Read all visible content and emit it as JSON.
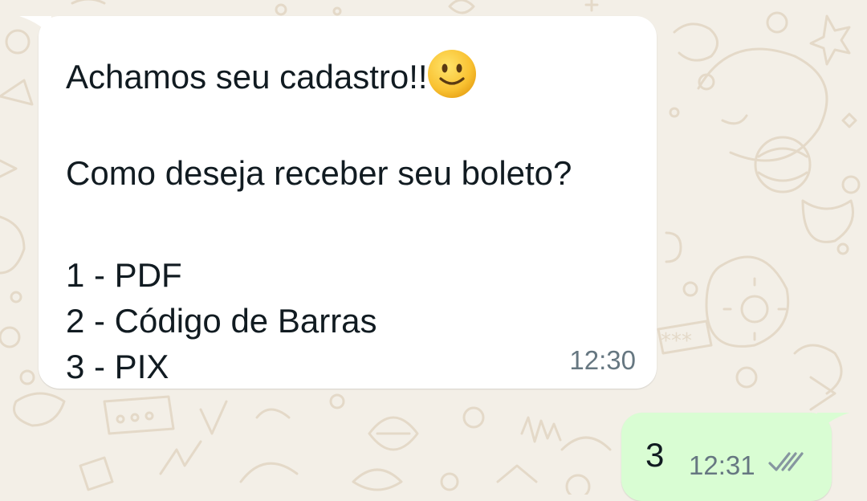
{
  "chat": {
    "incoming": {
      "line1": "Achamos seu cadastro!!",
      "emoji": "slightly-smiling-face",
      "line2": "Como deseja receber seu boleto?",
      "options": [
        "1 - PDF",
        "2 - Código de Barras",
        "3 - PIX"
      ],
      "time": "12:30"
    },
    "outgoing": {
      "text": "3",
      "time": "12:31",
      "status": "delivered-double-check"
    }
  },
  "colors": {
    "wallpaper": "#f3efe7",
    "incoming_bubble": "#ffffff",
    "outgoing_bubble": "#d9fdd3",
    "text": "#111b21",
    "timestamp": "#667781"
  }
}
